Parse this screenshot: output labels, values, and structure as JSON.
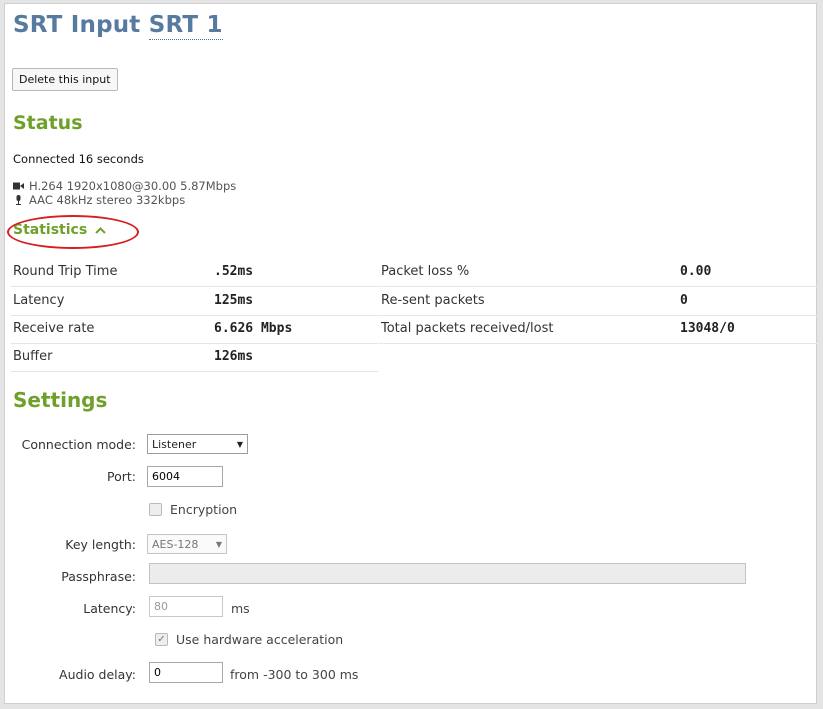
{
  "header": {
    "title_prefix": "SRT Input",
    "title_name": "SRT 1"
  },
  "actions": {
    "delete_label": "Delete this input"
  },
  "status": {
    "heading": "Status",
    "connected": "Connected 16 seconds",
    "video": "H.264 1920x1080@30.00 5.87Mbps",
    "audio": "AAC 48kHz stereo 332kbps",
    "video_icon": "video-camera-icon",
    "audio_icon": "microphone-icon"
  },
  "statistics": {
    "label": "Statistics",
    "expanded": true,
    "highlight_color": "#d42020",
    "left": [
      {
        "key": "Round Trip Time",
        "value": ".52ms"
      },
      {
        "key": "Latency",
        "value": "125ms"
      },
      {
        "key": "Receive rate",
        "value": "6.626 Mbps"
      },
      {
        "key": "Buffer",
        "value": "126ms"
      }
    ],
    "right": [
      {
        "key": "Packet loss %",
        "value": "0.00"
      },
      {
        "key": "Re-sent packets",
        "value": "0"
      },
      {
        "key": "Total packets received/lost",
        "value": "13048/0"
      }
    ]
  },
  "settings": {
    "heading": "Settings",
    "connection_mode": {
      "label": "Connection mode:",
      "value": "Listener"
    },
    "port": {
      "label": "Port:",
      "value": "6004"
    },
    "encryption": {
      "label": "Encryption",
      "checked": false
    },
    "key_length": {
      "label": "Key length:",
      "value": "AES-128"
    },
    "passphrase": {
      "label": "Passphrase:",
      "value": ""
    },
    "latency": {
      "label": "Latency:",
      "value": "80",
      "unit": "ms"
    },
    "hw_accel": {
      "label": "Use hardware acceleration",
      "checked": true
    },
    "audio_delay": {
      "label": "Audio delay:",
      "value": "0",
      "hint": "from -300 to 300 ms"
    }
  },
  "colors": {
    "title": "#567aa0",
    "section": "#6fa02a",
    "highlight": "#d42020"
  }
}
